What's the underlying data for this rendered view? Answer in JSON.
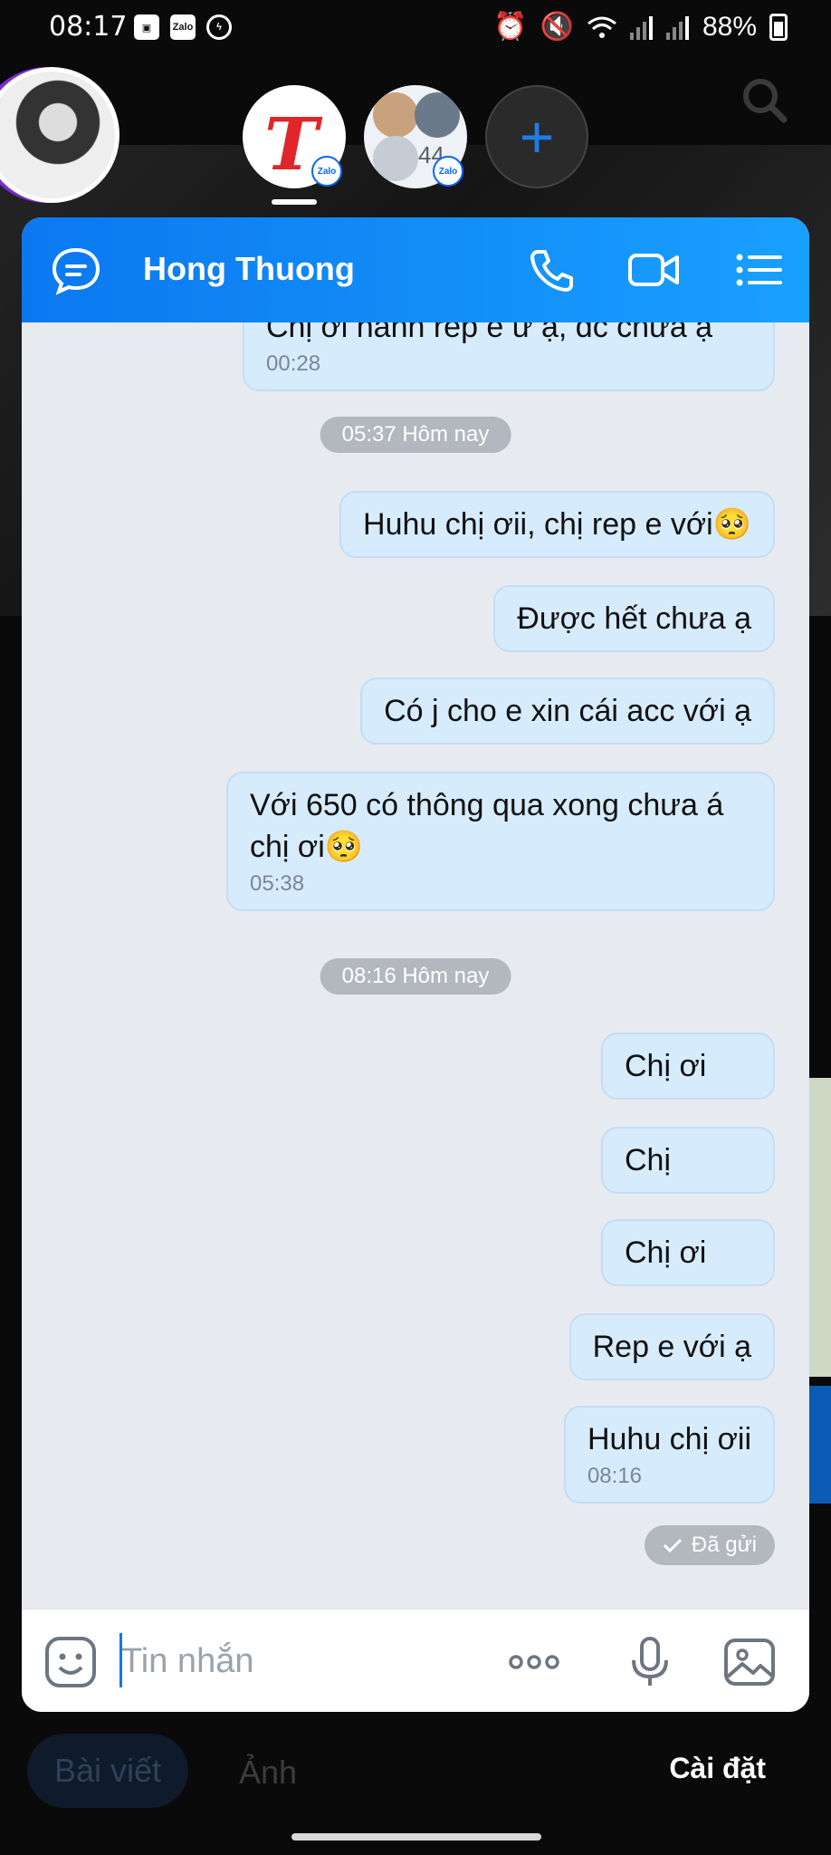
{
  "status_bar": {
    "time": "08:17",
    "left_app_icons": [
      "image-icon",
      "zalo-icon",
      "messenger-icon"
    ],
    "zalo_label": "Zalo",
    "right_icons": [
      "alarm-icon",
      "mute-icon",
      "wifi-icon",
      "signal-icon",
      "signal-icon"
    ],
    "battery": "88%"
  },
  "bubble_heads": {
    "group_count": "44",
    "badge_label": "Zalo",
    "add_icon": "plus-icon"
  },
  "chat": {
    "title": "Hong Thuong",
    "header_icons": [
      "chat-bubble-icon",
      "phone-icon",
      "video-camera-icon",
      "list-icon"
    ],
    "messages": [
      {
        "text": "Chị ơi hanh rep e ư ạ, đc chưa ạ",
        "time": "00:28"
      },
      {
        "text": "Huhu chị ơii, chị rep e với🥺"
      },
      {
        "text": "Được hết chưa ạ"
      },
      {
        "text": "Có j cho e xin cái acc với ạ"
      },
      {
        "text": "Với 650 có thông qua xong chưa á chị ơi🥺",
        "time": "05:38"
      },
      {
        "text": "Chị ơi"
      },
      {
        "text": "Chị"
      },
      {
        "text": "Chị ơi"
      },
      {
        "text": "Rep e với ạ"
      },
      {
        "text": "Huhu chị ơii",
        "time": "08:16"
      }
    ],
    "dividers": [
      "05:37 Hôm nay",
      "08:16 Hôm nay"
    ],
    "status": "Đã gửi",
    "composer": {
      "placeholder": "Tin nhắn",
      "icons": [
        "emoji-icon",
        "more-icon",
        "microphone-icon",
        "image-icon"
      ]
    }
  },
  "bottom_tabs": {
    "posts": "Bài viết",
    "photos": "Ảnh",
    "settings": "Cài đặt"
  },
  "colors": {
    "header_start": "#0b78f0",
    "header_end": "#19a0ff",
    "bubble": "#d6ebfc",
    "chat_bg": "#e7ebf0",
    "divider": "#b3b8be"
  }
}
